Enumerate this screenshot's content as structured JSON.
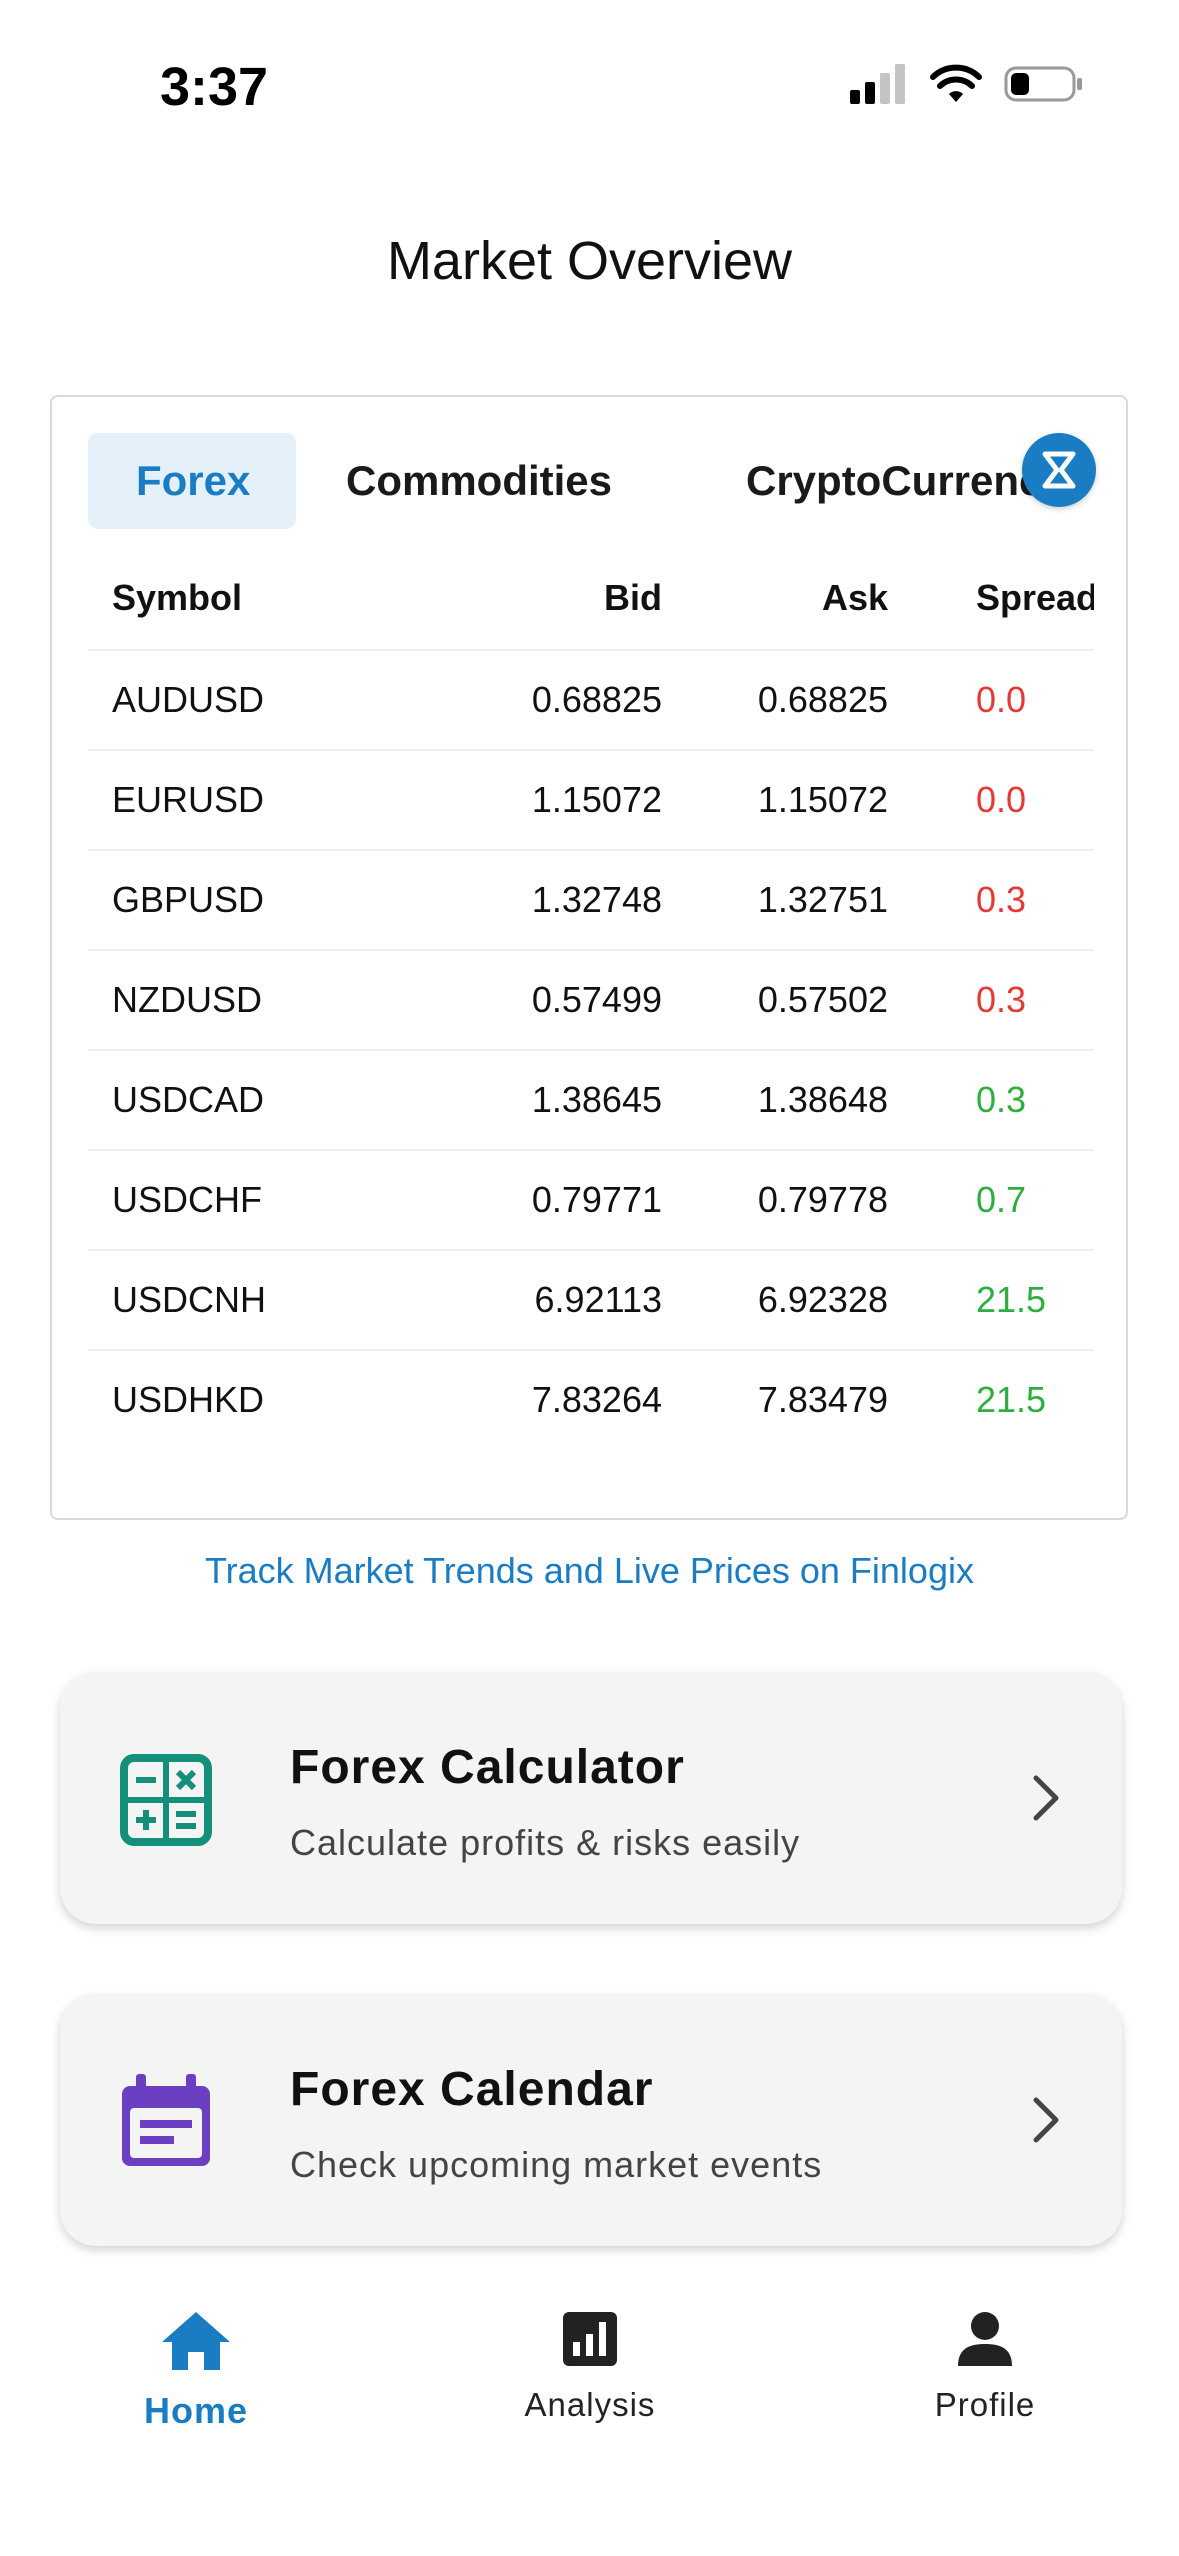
{
  "status_bar": {
    "time": "3:37"
  },
  "page": {
    "title": "Market Overview"
  },
  "tabs": [
    {
      "label": "Forex",
      "active": true
    },
    {
      "label": "Commodities",
      "active": false
    },
    {
      "label": "CryptoCurrenc",
      "active": false
    }
  ],
  "table": {
    "headers": {
      "symbol": "Symbol",
      "bid": "Bid",
      "ask": "Ask",
      "spread": "Spread"
    },
    "rows": [
      {
        "symbol": "AUDUSD",
        "bid": "0.68825",
        "ask": "0.68825",
        "spread": "0.0",
        "trend": "neg"
      },
      {
        "symbol": "EURUSD",
        "bid": "1.15072",
        "ask": "1.15072",
        "spread": "0.0",
        "trend": "neg"
      },
      {
        "symbol": "GBPUSD",
        "bid": "1.32748",
        "ask": "1.32751",
        "spread": "0.3",
        "trend": "neg"
      },
      {
        "symbol": "NZDUSD",
        "bid": "0.57499",
        "ask": "0.57502",
        "spread": "0.3",
        "trend": "neg"
      },
      {
        "symbol": "USDCAD",
        "bid": "1.38645",
        "ask": "1.38648",
        "spread": "0.3",
        "trend": "pos"
      },
      {
        "symbol": "USDCHF",
        "bid": "0.79771",
        "ask": "0.79778",
        "spread": "0.7",
        "trend": "pos"
      },
      {
        "symbol": "USDCNH",
        "bid": "6.92113",
        "ask": "6.92328",
        "spread": "21.5",
        "trend": "pos"
      },
      {
        "symbol": "USDHKD",
        "bid": "7.83264",
        "ask": "7.83479",
        "spread": "21.5",
        "trend": "pos"
      }
    ]
  },
  "track_link": "Track Market Trends and Live Prices on Finlogix",
  "features": {
    "calculator": {
      "title": "Forex Calculator",
      "subtitle": "Calculate profits & risks easily",
      "icon": "calculator-icon"
    },
    "calendar": {
      "title": "Forex Calendar",
      "subtitle": "Check upcoming market events",
      "icon": "calendar-icon"
    }
  },
  "nav": {
    "home": "Home",
    "analysis": "Analysis",
    "profile": "Profile"
  },
  "colors": {
    "accent": "#1a7dc4",
    "negative": "#e53935",
    "positive": "#2eae3f",
    "calculator_icon": "#14907a",
    "calendar_icon": "#6a3fc1"
  }
}
